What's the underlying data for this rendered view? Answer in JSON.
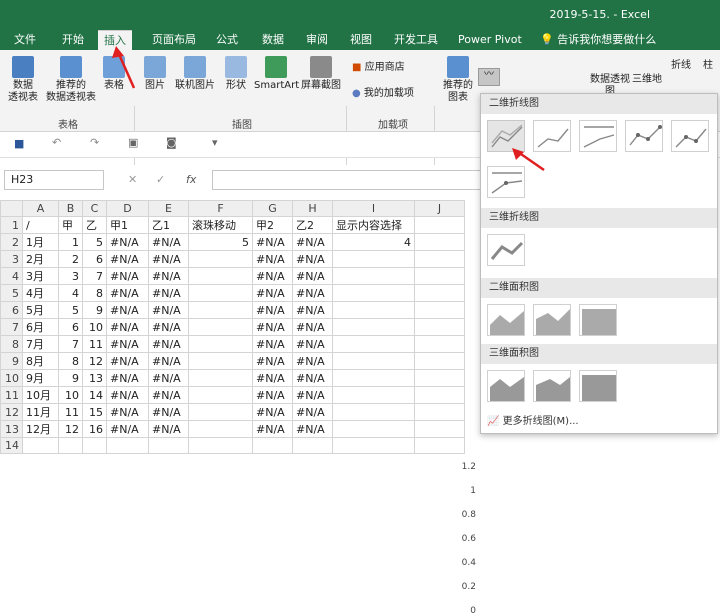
{
  "title": "2019-5-15. - Excel",
  "tabs": [
    "文件",
    "开始",
    "插入",
    "页面布局",
    "公式",
    "数据",
    "审阅",
    "视图",
    "开发工具",
    "Power Pivot"
  ],
  "tell_me": "告诉我你想要做什么",
  "ribbon": {
    "pivot": "数据\n透视表",
    "rec_pivot": "推荐的\n数据透视表",
    "table": "表格",
    "picture": "图片",
    "online_picture": "联机图片",
    "shapes": "形状",
    "smartart": "SmartArt",
    "screenshot": "屏幕截图",
    "app_store": "应用商店",
    "my_addins": "我的加载项",
    "rec_charts": "推荐的\n图表",
    "pivot_chart": "数据透视图",
    "map3d": "三维地",
    "line_spark": "折线",
    "col_spark": "柱",
    "grp_tables": "表格",
    "grp_illus": "插图",
    "grp_addins": "加载项"
  },
  "namebox": "H23",
  "fx": "fx",
  "columns": [
    "",
    "A",
    "B",
    "C",
    "D",
    "E",
    "F",
    "G",
    "H",
    "I",
    "J"
  ],
  "rows": [
    [
      "1",
      "/",
      "甲",
      "乙",
      "甲1",
      "乙1",
      "滚珠移动",
      "甲2",
      "乙2",
      "显示内容选择"
    ],
    [
      "2",
      "1月",
      "1",
      "5",
      "#N/A",
      "#N/A",
      "5",
      "#N/A",
      "#N/A",
      "4"
    ],
    [
      "3",
      "2月",
      "2",
      "6",
      "#N/A",
      "#N/A",
      "",
      "#N/A",
      "#N/A",
      ""
    ],
    [
      "4",
      "3月",
      "3",
      "7",
      "#N/A",
      "#N/A",
      "",
      "#N/A",
      "#N/A",
      ""
    ],
    [
      "5",
      "4月",
      "4",
      "8",
      "#N/A",
      "#N/A",
      "",
      "#N/A",
      "#N/A",
      ""
    ],
    [
      "6",
      "5月",
      "5",
      "9",
      "#N/A",
      "#N/A",
      "",
      "#N/A",
      "#N/A",
      ""
    ],
    [
      "7",
      "6月",
      "6",
      "10",
      "#N/A",
      "#N/A",
      "",
      "#N/A",
      "#N/A",
      ""
    ],
    [
      "8",
      "7月",
      "7",
      "11",
      "#N/A",
      "#N/A",
      "",
      "#N/A",
      "#N/A",
      ""
    ],
    [
      "9",
      "8月",
      "8",
      "12",
      "#N/A",
      "#N/A",
      "",
      "#N/A",
      "#N/A",
      ""
    ],
    [
      "10",
      "9月",
      "9",
      "13",
      "#N/A",
      "#N/A",
      "",
      "#N/A",
      "#N/A",
      ""
    ],
    [
      "11",
      "10月",
      "10",
      "14",
      "#N/A",
      "#N/A",
      "",
      "#N/A",
      "#N/A",
      ""
    ],
    [
      "12",
      "11月",
      "11",
      "15",
      "#N/A",
      "#N/A",
      "",
      "#N/A",
      "#N/A",
      ""
    ],
    [
      "13",
      "12月",
      "12",
      "16",
      "#N/A",
      "#N/A",
      "",
      "#N/A",
      "#N/A",
      ""
    ],
    [
      "14",
      "",
      "",
      "",
      "",
      "",
      "",
      "",
      "",
      ""
    ]
  ],
  "chart_axis": [
    "1.2",
    "1",
    "0.8",
    "0.6",
    "0.4",
    "0.2",
    "0"
  ],
  "dropdown": {
    "s1": "二维折线图",
    "s2": "三维折线图",
    "s3": "二维面积图",
    "s4": "三维面积图",
    "more": "更多折线图(M)..."
  },
  "colors": {
    "accent": "#217346",
    "arrow": "#e02020"
  }
}
